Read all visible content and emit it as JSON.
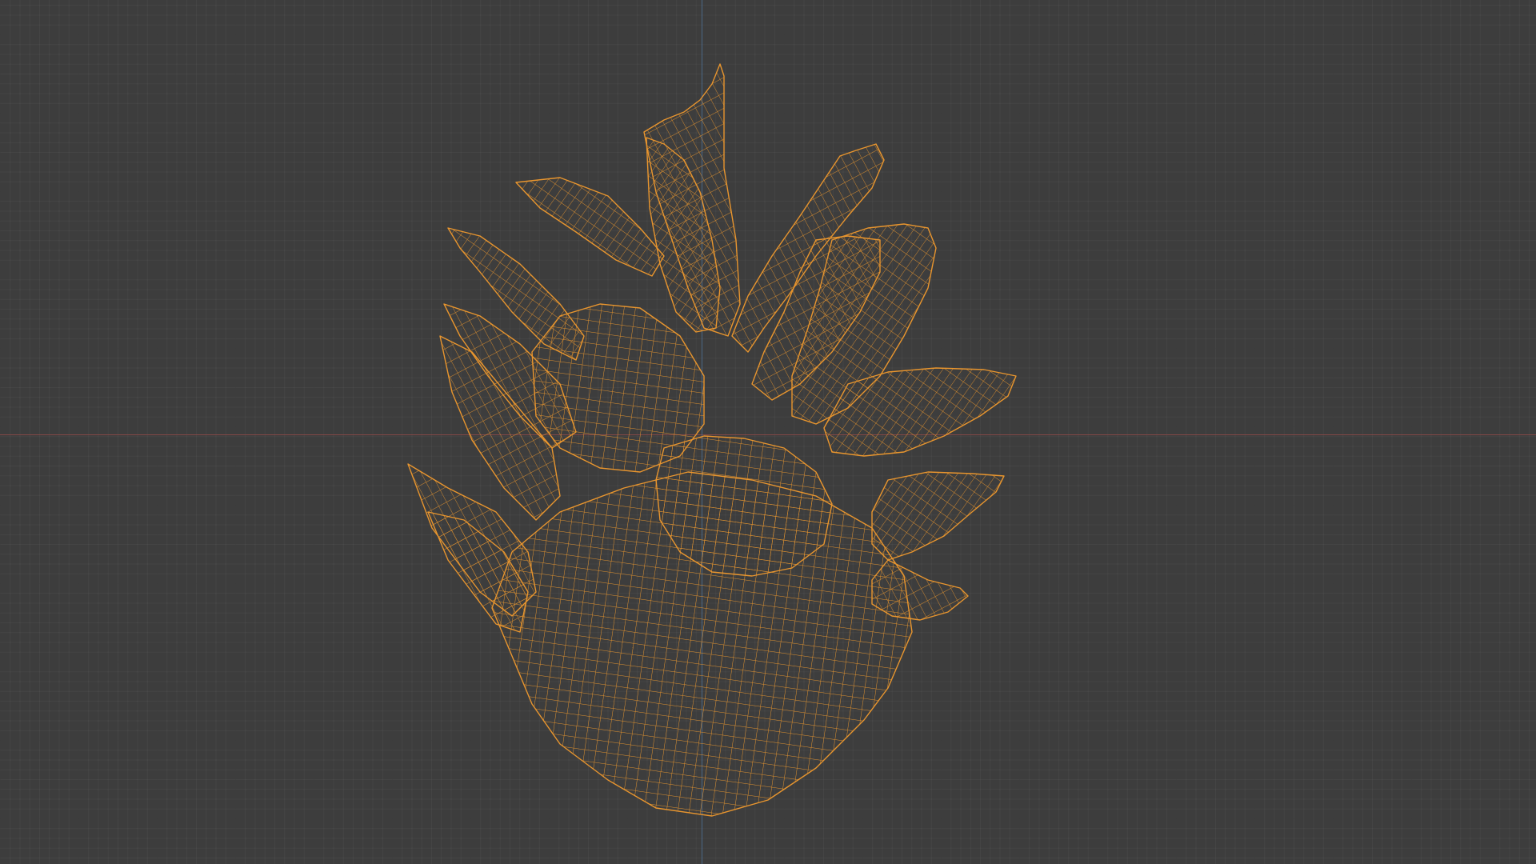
{
  "viewport": {
    "shading": "wireframe",
    "grid": true,
    "background_color": "#3d3d3d",
    "x_axis_color": "#8f4a48",
    "y_axis_color": "#4e6e93"
  },
  "object": {
    "kind": "mesh",
    "selected": true,
    "wire_color": "#e8952e"
  }
}
